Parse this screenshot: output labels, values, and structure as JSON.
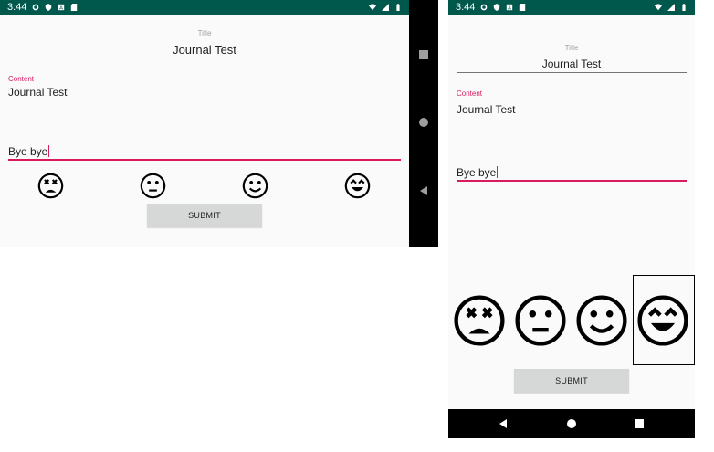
{
  "status_bar": {
    "time": "3:44"
  },
  "form": {
    "title_label": "Title",
    "title_value": "Journal Test",
    "content_label": "Content",
    "content_value": "Journal Test",
    "input_value": "Bye bye",
    "submit_label": "SUBMIT"
  },
  "moods": [
    "dead-face-icon",
    "neutral-face-icon",
    "smile-face-icon",
    "grin-face-icon"
  ],
  "selected_mood_right": "grin-face-icon",
  "colors": {
    "status_bar": "#00574b",
    "accent": "#d81b60",
    "background": "#fafafa",
    "button": "#d6d7d7",
    "nav_bar": "#000000"
  }
}
